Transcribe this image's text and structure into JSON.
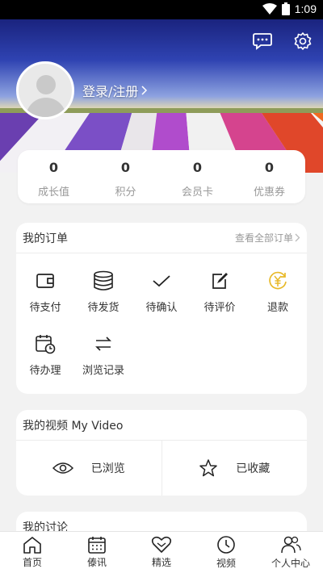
{
  "status_bar": {
    "time": "1:09"
  },
  "header": {
    "login_label": "登录/注册",
    "icons": [
      "message-icon",
      "gear-icon"
    ]
  },
  "stats": [
    {
      "value": "0",
      "label": "成长值"
    },
    {
      "value": "0",
      "label": "积分"
    },
    {
      "value": "0",
      "label": "会员卡"
    },
    {
      "value": "0",
      "label": "优惠券"
    }
  ],
  "orders": {
    "title": "我的订单",
    "view_all": "查看全部订单",
    "items": [
      {
        "label": "待支付",
        "icon": "wallet-icon"
      },
      {
        "label": "待发货",
        "icon": "coins-icon"
      },
      {
        "label": "待确认",
        "icon": "check-icon"
      },
      {
        "label": "待评价",
        "icon": "edit-icon"
      },
      {
        "label": "退款",
        "icon": "refund-yen-icon"
      },
      {
        "label": "待办理",
        "icon": "calendar-clock-icon"
      },
      {
        "label": "浏览记录",
        "icon": "swap-arrows-icon"
      }
    ],
    "accent": "#e8b928"
  },
  "videos": {
    "title": "我的视频  My Video",
    "viewed": "已浏览",
    "favorited": "已收藏"
  },
  "discussion": {
    "title": "我的讨论"
  },
  "tabbar": [
    {
      "label": "首页",
      "icon": "home-icon"
    },
    {
      "label": "傣讯",
      "icon": "calendar-icon"
    },
    {
      "label": "精选",
      "icon": "heart-icon"
    },
    {
      "label": "视频",
      "icon": "clock-icon"
    },
    {
      "label": "个人中心",
      "icon": "people-icon"
    }
  ]
}
